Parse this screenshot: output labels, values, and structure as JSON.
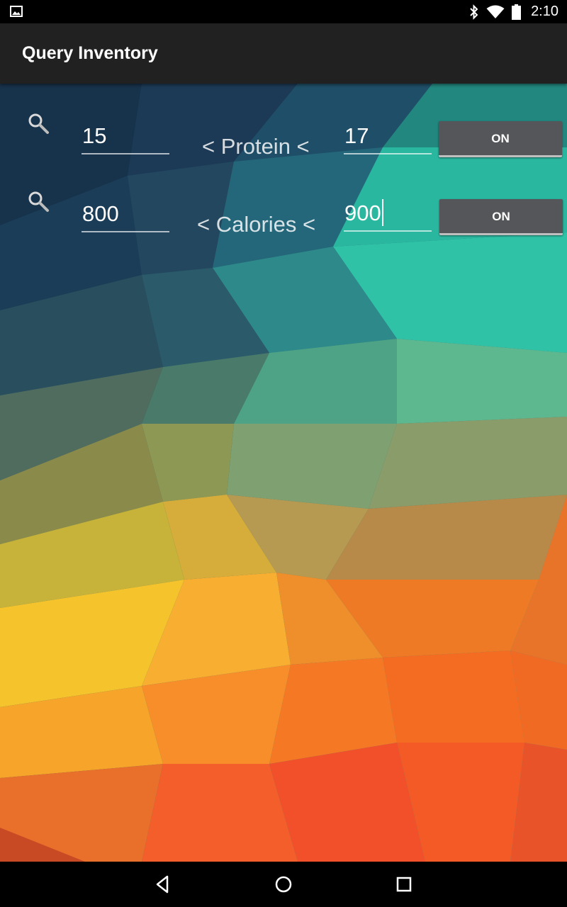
{
  "status_bar": {
    "time": "2:10",
    "icons": [
      "image-notification-icon",
      "bluetooth-icon",
      "wifi-icon",
      "battery-icon"
    ]
  },
  "app_bar": {
    "title": "Query Inventory"
  },
  "filters": [
    {
      "min_value": "15",
      "label": "< Protein <",
      "max_value": "17",
      "toggle_label": "ON"
    },
    {
      "min_value": "800",
      "label": "< Calories <",
      "max_value": "900",
      "toggle_label": "ON"
    }
  ],
  "navigation_bar": {
    "icons": [
      "back-icon",
      "home-icon",
      "recents-icon"
    ]
  }
}
